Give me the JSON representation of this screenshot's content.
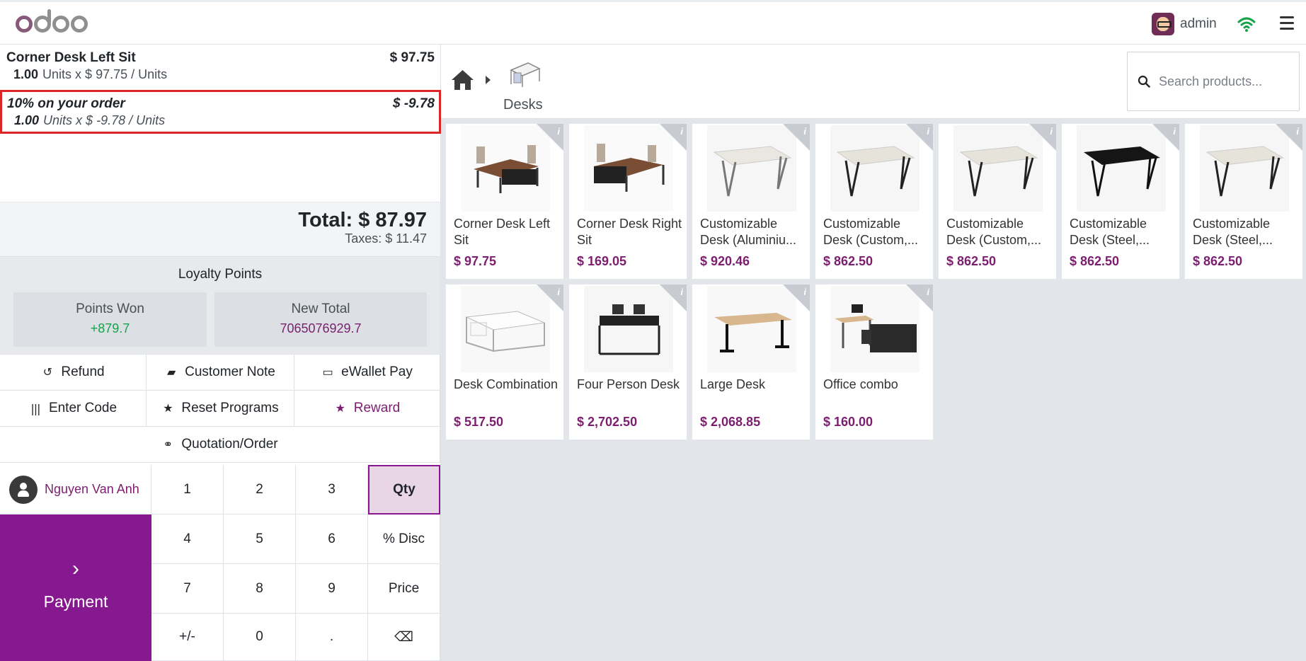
{
  "header": {
    "username": "admin"
  },
  "order": {
    "lines": [
      {
        "name": "Corner Desk Left Sit",
        "price": "$ 97.75",
        "qty": "1.00",
        "detail": "Units x $ 97.75 / Units"
      },
      {
        "name": "10% on your order",
        "price": "$ -9.78",
        "qty": "1.00",
        "detail": "Units x $ -9.78 / Units"
      }
    ],
    "total": "Total: $ 87.97",
    "taxes": "Taxes: $ 11.47"
  },
  "loyalty": {
    "title": "Loyalty Points",
    "points_won_label": "Points Won",
    "points_won": "+879.7",
    "new_total_label": "New Total",
    "new_total": "7065076929.7"
  },
  "controls": {
    "refund": "Refund",
    "customer_note": "Customer Note",
    "ewallet_pay": "eWallet Pay",
    "enter_code": "Enter Code",
    "reset_programs": "Reset Programs",
    "reward": "Reward",
    "quotation": "Quotation/Order"
  },
  "customer": {
    "name": "Nguyen Van Anh"
  },
  "payment": {
    "label": "Payment"
  },
  "numpad": {
    "k1": "1",
    "k2": "2",
    "k3": "3",
    "qty": "Qty",
    "k4": "4",
    "k5": "5",
    "k6": "6",
    "disc": "% Disc",
    "k7": "7",
    "k8": "8",
    "k9": "9",
    "price": "Price",
    "plusminus": "+/-",
    "k0": "0",
    "dot": ".",
    "backspace": "⌫"
  },
  "breadcrumb": {
    "category": "Desks"
  },
  "search": {
    "placeholder": "Search products..."
  },
  "products": [
    {
      "name": "Corner Desk Left Sit",
      "price": "$ 97.75"
    },
    {
      "name": "Corner Desk Right Sit",
      "price": "$ 169.05"
    },
    {
      "name": "Customizable Desk (Aluminiu...",
      "price": "$ 920.46"
    },
    {
      "name": "Customizable Desk (Custom,...",
      "price": "$ 862.50"
    },
    {
      "name": "Customizable Desk (Custom,...",
      "price": "$ 862.50"
    },
    {
      "name": "Customizable Desk (Steel,...",
      "price": "$ 862.50"
    },
    {
      "name": "Customizable Desk (Steel,...",
      "price": "$ 862.50"
    },
    {
      "name": "Desk Combination",
      "price": "$ 517.50"
    },
    {
      "name": "Four Person Desk",
      "price": "$ 2,702.50"
    },
    {
      "name": "Large Desk",
      "price": "$ 2,068.85"
    },
    {
      "name": "Office combo",
      "price": "$ 160.00"
    }
  ],
  "colors": {
    "brand": "#86198f",
    "accent_text": "#7c1e6f",
    "points_green": "#16a34a",
    "selected_border": "#dc2626"
  }
}
